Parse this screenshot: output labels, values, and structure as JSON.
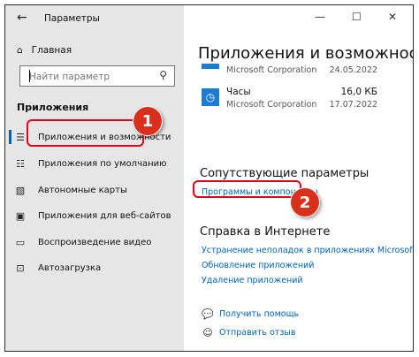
{
  "window": {
    "title": "Параметры",
    "back_glyph": "←",
    "controls": {
      "minimize": "—",
      "maximize": "☐",
      "close": "✕"
    }
  },
  "sidebar": {
    "home_label": "Главная",
    "search_placeholder": "Найти параметр",
    "section_title": "Приложения",
    "items": [
      {
        "label": "Приложения и возможности",
        "icon": "apps-features-icon",
        "selected": true
      },
      {
        "label": "Приложения по умолчанию",
        "icon": "default-apps-icon"
      },
      {
        "label": "Автономные карты",
        "icon": "offline-maps-icon"
      },
      {
        "label": "Приложения для веб-сайтов",
        "icon": "apps-for-websites-icon"
      },
      {
        "label": "Воспроизведение видео",
        "icon": "video-playback-icon"
      },
      {
        "label": "Автозагрузка",
        "icon": "startup-icon"
      }
    ]
  },
  "main": {
    "title": "Приложения и возможности",
    "apps": [
      {
        "name": "",
        "publisher": "Microsoft Corporation",
        "size": "",
        "date": "24.05.2022"
      },
      {
        "name": "Часы",
        "publisher": "Microsoft Corporation",
        "size": "16,0 КБ",
        "date": "17.07.2022"
      }
    ],
    "related_title": "Сопутствующие параметры",
    "related_link": "Программы и компоненты",
    "help_title": "Справка в Интернете",
    "help_links": [
      "Устранение неполадок в приложениях Microsoft Store",
      "Обновление приложений",
      "Удаление приложений"
    ],
    "get_help": "Получить помощь",
    "feedback": "Отправить отзыв"
  },
  "annotations": {
    "badge_1": "1",
    "badge_2": "2",
    "highlight_color": "#e2001a"
  },
  "colors": {
    "accent": "#0063b1",
    "sidebar_bg": "#e6e6e6",
    "badge": "#d9301e"
  }
}
